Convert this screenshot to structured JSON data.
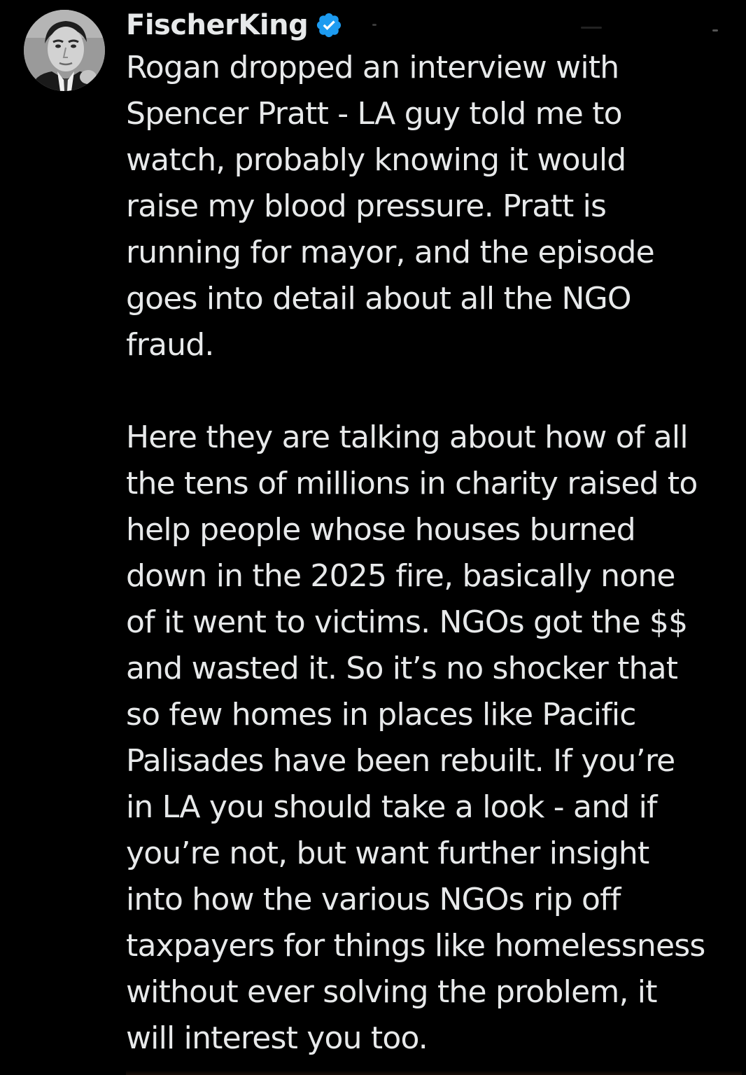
{
  "post": {
    "author": {
      "display_name": "FischerKing",
      "verified": true,
      "avatar_icon": "grayscale-portrait-avatar"
    },
    "lines": [
      "Rogan dropped an interview with",
      "Spencer Pratt - LA guy told me to",
      "watch, probably knowing it would",
      "raise my blood pressure. Pratt is",
      "running for mayor, and the episode",
      "goes into detail about all the NGO",
      "fraud.",
      "",
      "Here they are talking about how of all",
      "the tens of millions in charity raised to",
      "help people whose houses burned",
      "down in the 2025 fire, basically none",
      "of it went to victims. NGOs got the $$",
      "and wasted it. So it’s no shocker that",
      "so few homes in places like Pacific",
      "Palisades have been rebuilt. If you’re",
      "in LA you should take a look - and if",
      "you’re not, but want further insight",
      "into how the various NGOs rip off",
      "taxpayers for things like homelessness",
      "without ever solving the problem, it",
      "will interest you too."
    ]
  },
  "colors": {
    "background": "#000000",
    "text": "#e7e9ea",
    "verified_badge": "#1d9bf0"
  }
}
